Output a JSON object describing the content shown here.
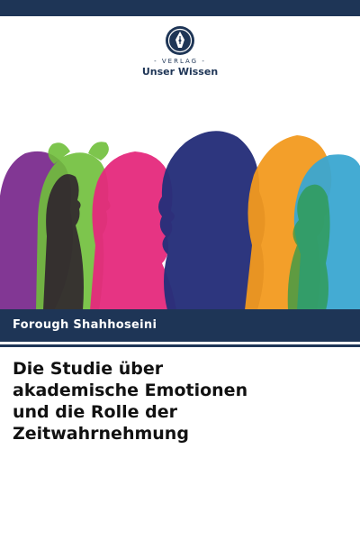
{
  "publisher": {
    "verlag_label": "- VERLAG -",
    "name": "Unser Wissen"
  },
  "author": "Forough Shahhoseini",
  "title_lines": [
    "Die Studie über",
    "akademische Emotionen",
    "und die Rolle der",
    "Zeitwahrnehmung"
  ],
  "colors": {
    "brand_navy": "#1e3556",
    "silhouettes": [
      "#7b2c8e",
      "#6fbf3a",
      "#e5297c",
      "#26307a",
      "#f29a1f",
      "#3aa7d1"
    ]
  }
}
